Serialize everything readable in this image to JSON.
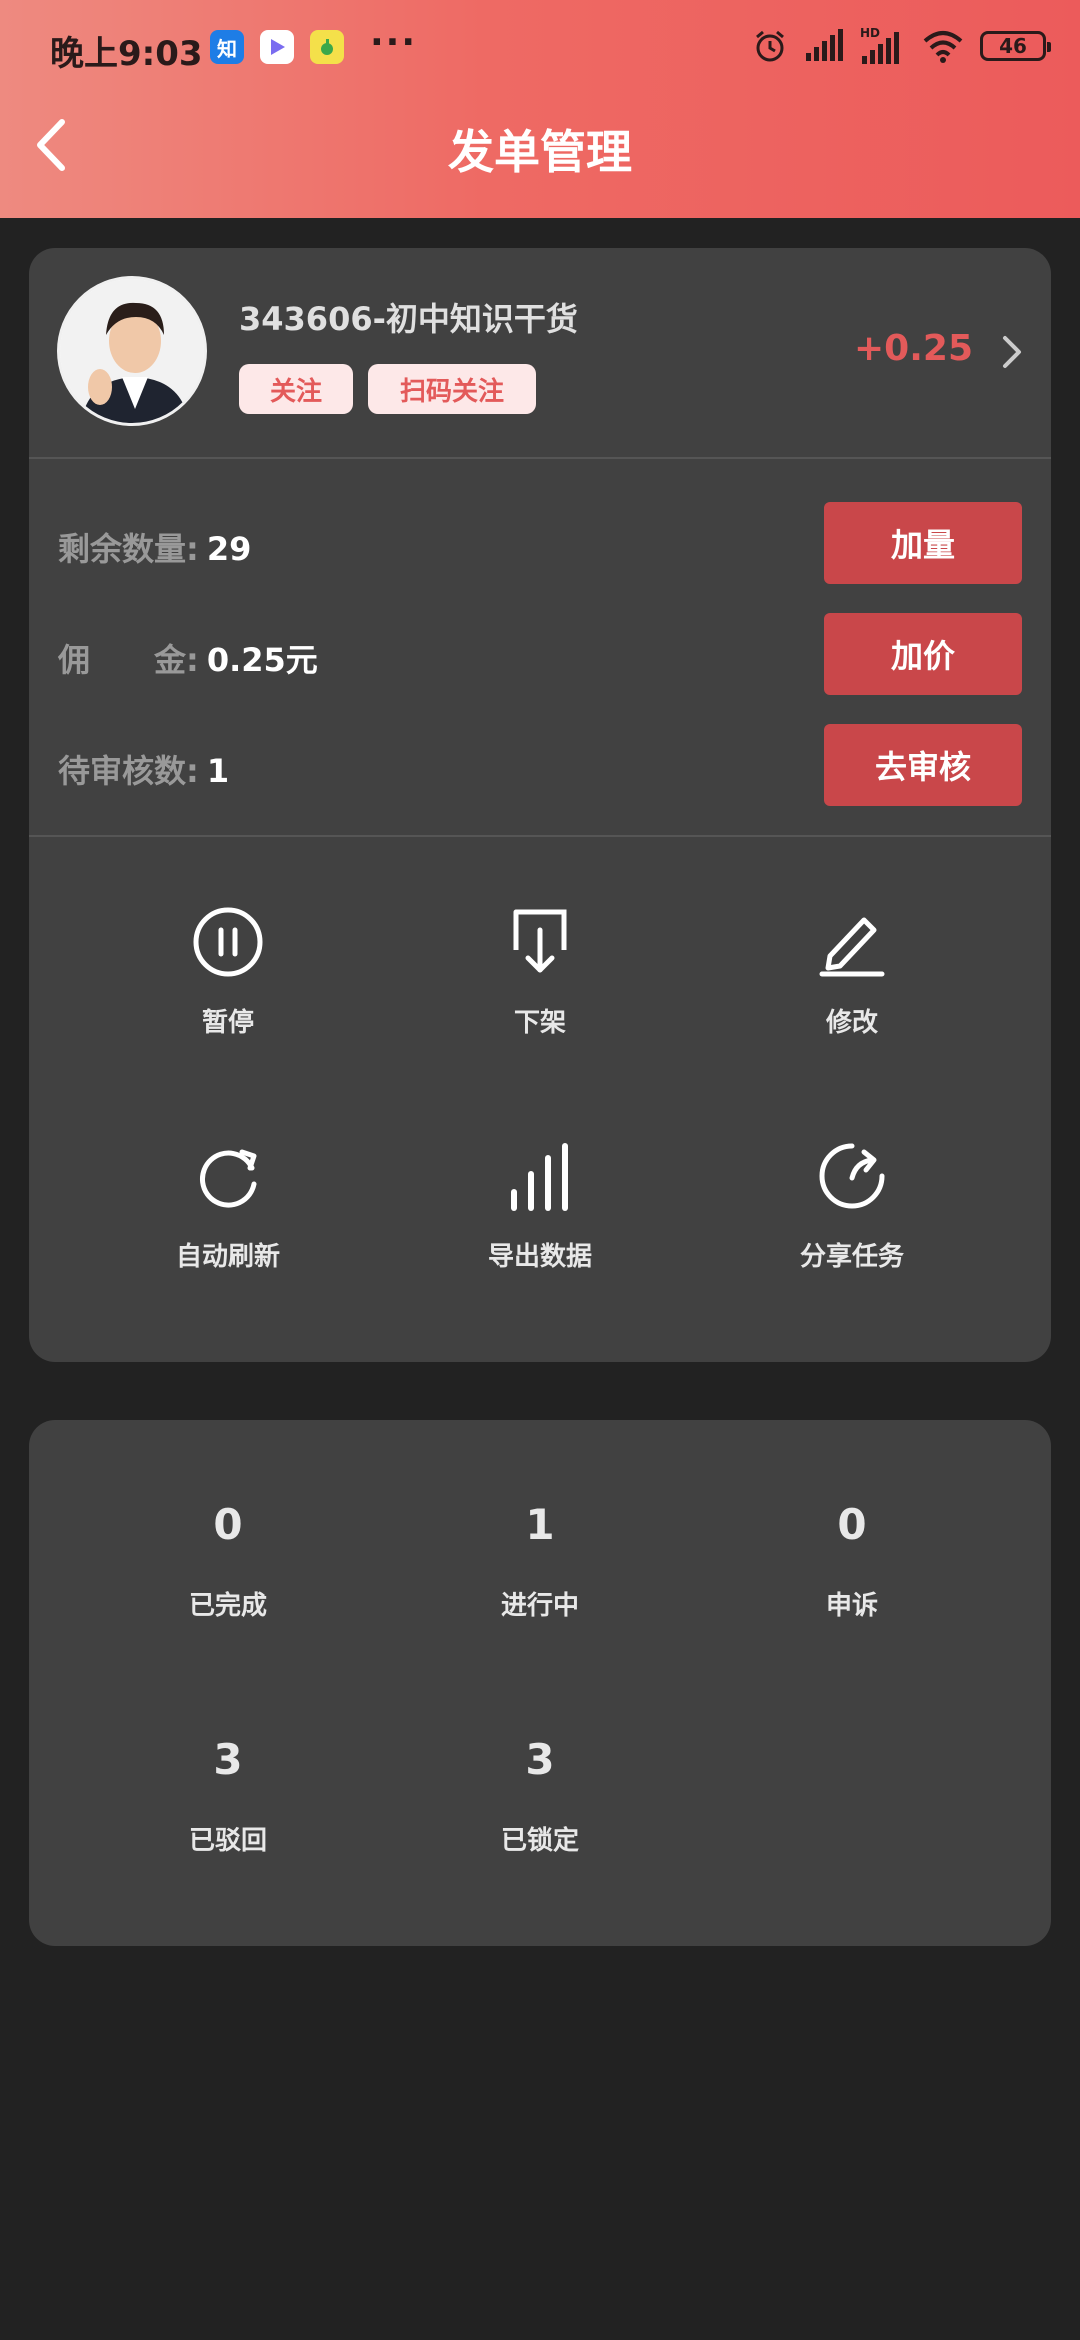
{
  "status_bar": {
    "time": "晚上9:03",
    "app_icons": [
      "zhihu-icon",
      "video-play-icon",
      "music-icon"
    ],
    "more": "···",
    "battery": "46"
  },
  "header": {
    "title": "发单管理",
    "background_gradient": [
      "#ee8a80",
      "#ec5b5b"
    ]
  },
  "task": {
    "account_name": "343606-初中知识干货",
    "tags": [
      "关注",
      "扫码关注"
    ],
    "price_delta": "+0.25",
    "info": [
      {
        "label": "剩余数量:",
        "value": "29"
      },
      {
        "label": "佣　　金:",
        "value": "0.25元"
      },
      {
        "label": "待审核数:",
        "value": "1"
      }
    ],
    "buttons": [
      "加量",
      "加价",
      "去审核"
    ],
    "accent_color": "#c9474a"
  },
  "tools": [
    {
      "label": "暂停",
      "icon": "pause-icon"
    },
    {
      "label": "下架",
      "icon": "download-tray-icon"
    },
    {
      "label": "修改",
      "icon": "pencil-icon"
    },
    {
      "label": "自动刷新",
      "icon": "refresh-icon"
    },
    {
      "label": "导出数据",
      "icon": "bar-chart-icon"
    },
    {
      "label": "分享任务",
      "icon": "share-icon"
    }
  ],
  "stats": [
    {
      "value": "0",
      "label": "已完成"
    },
    {
      "value": "1",
      "label": "进行中"
    },
    {
      "value": "0",
      "label": "申诉"
    },
    {
      "value": "3",
      "label": "已驳回"
    },
    {
      "value": "3",
      "label": "已锁定"
    }
  ]
}
